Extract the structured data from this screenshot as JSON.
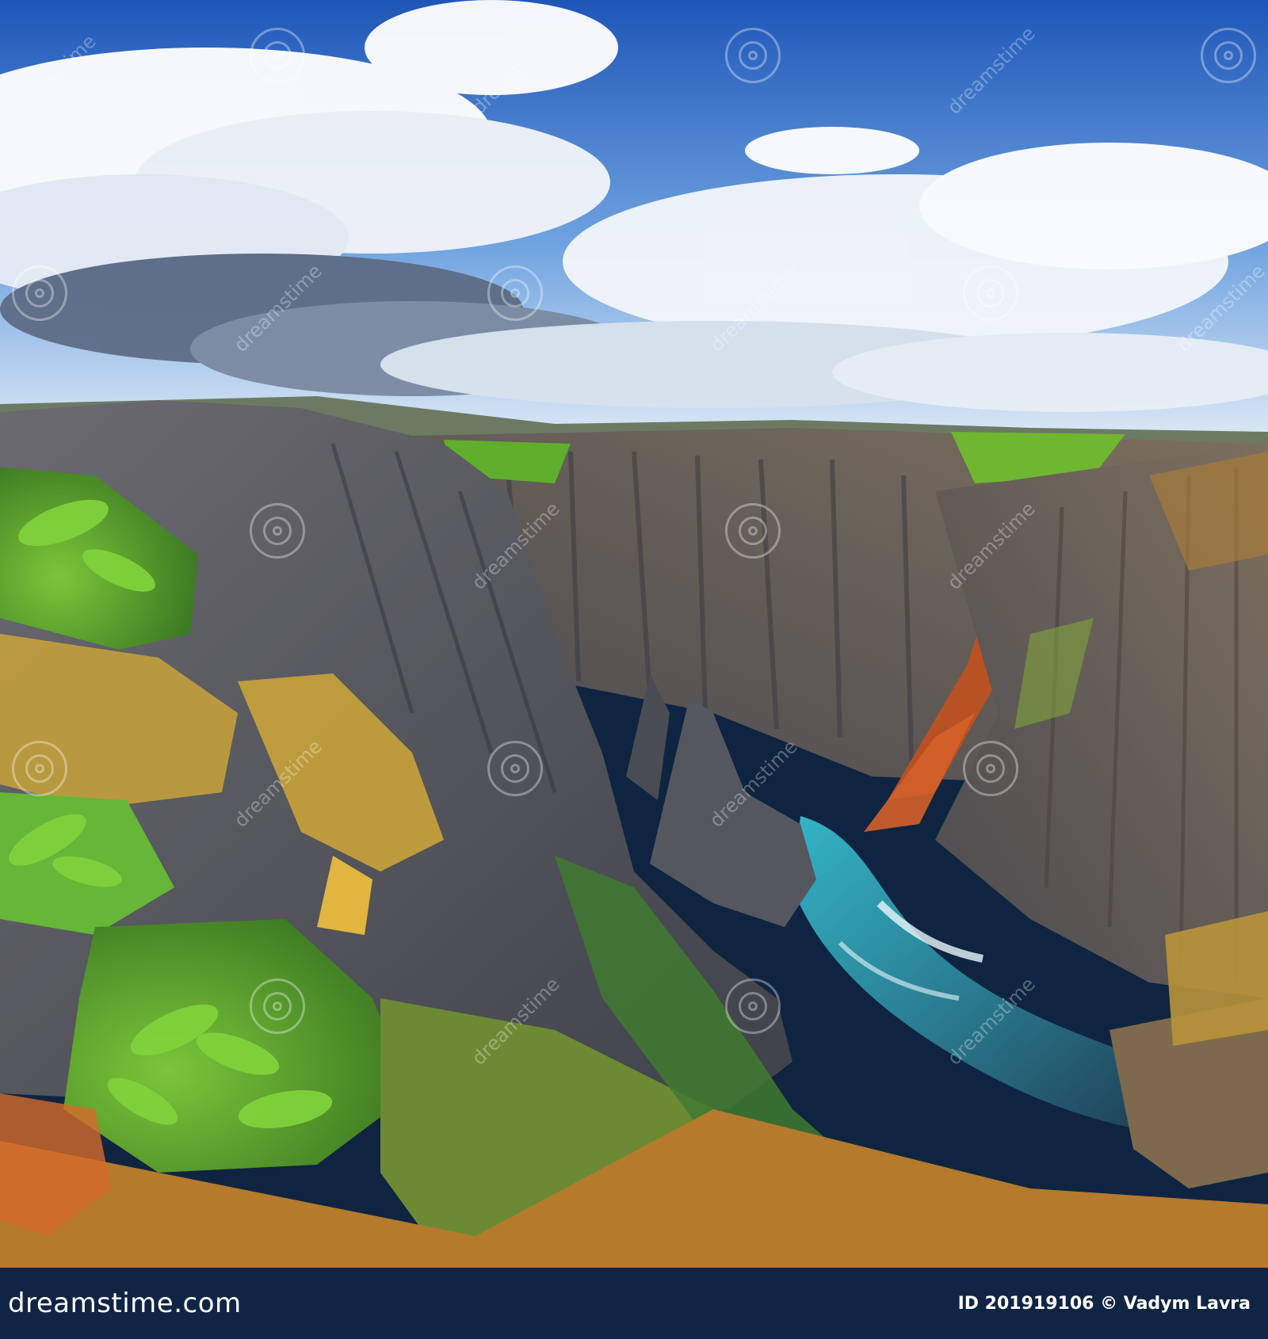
{
  "photo": {
    "subject": "canyon-landscape",
    "colors": {
      "sky_top": "#1f5fc4",
      "sky_bottom": "#cfe2f7",
      "cloud": "#ffffff",
      "cloud_shadow": "#5b6a82",
      "rock_dark": "#4c4f58",
      "rock_light": "#8a8a90",
      "moss_green": "#5fae2c",
      "moss_yellow": "#c9a33a",
      "rust": "#c2501e",
      "river": "#2aa3b8"
    }
  },
  "watermark": {
    "text": "dreamstime",
    "icon": "spiral-logo-icon"
  },
  "footer": {
    "brand": "dreamstime.com",
    "credit": "ID 201919106 © Vadym Lavra"
  }
}
